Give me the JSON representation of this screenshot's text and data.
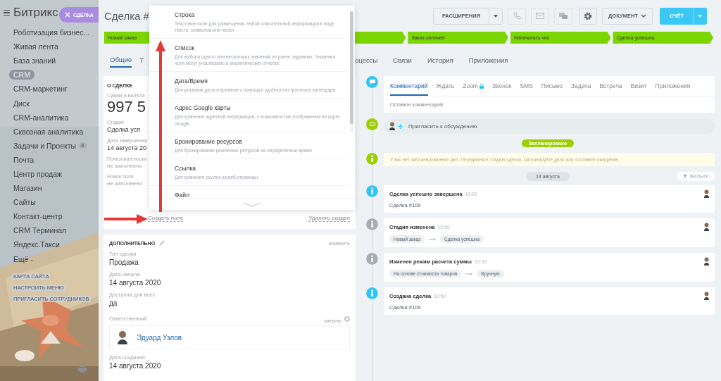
{
  "sidebar": {
    "logo": "Битрикс",
    "tag": {
      "label": "СДЕЛКА"
    },
    "items": [
      {
        "label": "Роботизация бизнес...",
        "selected": false
      },
      {
        "label": "Живая лента",
        "selected": false
      },
      {
        "label": "База знаний",
        "selected": false
      },
      {
        "label": "CRM",
        "selected": true
      },
      {
        "label": "CRM-маркетинг",
        "selected": false
      },
      {
        "label": "Диск",
        "selected": false
      },
      {
        "label": "CRM-аналитика",
        "selected": false
      },
      {
        "label": "Сквозная аналитика",
        "selected": false
      },
      {
        "label": "Задачи и Проекты",
        "badge": "4",
        "selected": false
      },
      {
        "label": "Почта",
        "selected": false
      },
      {
        "label": "Центр продаж",
        "selected": false
      },
      {
        "label": "Магазин",
        "selected": false
      },
      {
        "label": "Сайты",
        "selected": false
      },
      {
        "label": "Контакт-центр",
        "selected": false
      },
      {
        "label": "CRM Терминал",
        "selected": false
      },
      {
        "label": "Яндекс.Такси",
        "selected": false
      },
      {
        "label": "Ещё -",
        "selected": false
      }
    ],
    "footer_links": [
      "КАРТА САЙТА",
      "НАСТРОИТЬ МЕНЮ",
      "ПРИГЛАСИТЬ СОТРУДНИКОВ"
    ]
  },
  "header": {
    "title": "Сделка #",
    "extensions": "РАСШИРЕНИЯ",
    "document": "ДОКУМЕНТ",
    "invoice": "СЧЁТ"
  },
  "stages": [
    {
      "kind": "shown",
      "label": "Новый заказ"
    },
    {
      "kind": "covered"
    },
    {
      "kind": "shown",
      "label": "Заказ оплачен"
    },
    {
      "kind": "shown",
      "label": "Напечатать чек"
    },
    {
      "kind": "shown",
      "label": "Сделка успешна"
    }
  ],
  "tabs": [
    {
      "label": "Общие",
      "selected": true
    },
    {
      "label": "Т",
      "selected": false
    },
    {
      "label": "оцессы",
      "selected": false
    },
    {
      "label": "Связи",
      "selected": false
    },
    {
      "label": "История",
      "selected": false
    },
    {
      "label": "Приложения",
      "selected": false
    }
  ],
  "deal_card": {
    "title": "О СДЕЛКЕ",
    "fields": [
      {
        "kind": "amount",
        "label": "Сумма и валюта",
        "value": "997 5"
      },
      {
        "kind": "text",
        "label": "Стадия",
        "value": "Сделка усп"
      },
      {
        "kind": "text",
        "label": "Дата завершения",
        "value": "14 августа 20"
      },
      {
        "kind": "empty",
        "label": "Пользовательски",
        "value": "не заполнено"
      },
      {
        "kind": "empty",
        "label": "Новое поле",
        "value": "не заполнено"
      }
    ],
    "create_link": "Создать поле",
    "delete_link": "Удалить раздел"
  },
  "field_menu": [
    {
      "title": "Строка",
      "description": "Текстовое поле для размещения любой описательной информации в виде текста, символов или чисел."
    },
    {
      "title": "Список",
      "description": "Для выбора одного или нескольких значений из ранее заданных. Значения поля могут участвовать в аналитических отчетах."
    },
    {
      "title": "Дата/Время",
      "description": "Для указания даты и времени с помощью удобного встроенного календаря."
    },
    {
      "title": "Адрес Google карты",
      "description": "Для хранения адресной информации, с возможностью отображения на карте Google."
    },
    {
      "title": "Бронирование ресурсов",
      "description": "Для бронирования различных ресурсов на определенное время"
    },
    {
      "title": "Ссылка",
      "description": "Для хранения ссылок на веб-страницы."
    },
    {
      "title": "Файл"
    }
  ],
  "extra_card": {
    "title": "ДОПОЛНИТЕЛЬНО",
    "edit_link": "изменить",
    "fields": [
      {
        "label": "Тип сделки",
        "value": "Продажа"
      },
      {
        "label": "Дата начала",
        "value": "14 августа 2020"
      },
      {
        "label": "Доступна для всех",
        "value": "да"
      }
    ],
    "responsible": {
      "label": "Ответственный",
      "change": "сменить",
      "name": "Эдуард Узлов"
    },
    "created": {
      "label": "Дата создания",
      "value": "14 августа 2020"
    }
  },
  "activity_tabs": [
    {
      "label": "Комментарий",
      "selected": true
    },
    {
      "label": "Ждать",
      "selected": false
    },
    {
      "label": "Zoom",
      "selected": false,
      "locked": true
    },
    {
      "label": "Звонок",
      "selected": false
    },
    {
      "label": "SMS",
      "selected": false
    },
    {
      "label": "Письмо",
      "selected": false
    },
    {
      "label": "Задача",
      "selected": false
    },
    {
      "label": "Встреча",
      "selected": false
    },
    {
      "label": "Визит",
      "selected": false
    },
    {
      "label": "Приложения",
      "selected": false
    }
  ],
  "comment_placeholder": "Оставьте комментарий",
  "invite": "Пригласить к обсуждению",
  "planned_badge": "Запланировано",
  "planned_notice": "У вас нет запланированных дел. Передвиньте стадию сделки, запланируйте дело или поставьте ожидание.",
  "date_badge": "14 августа",
  "filter": "ФИЛЬТР",
  "events": [
    {
      "kind": "text",
      "color": "#2fc6f6",
      "title": "Сделка успешно завершена",
      "time": "10:50",
      "text": "Сделка #109"
    },
    {
      "kind": "change",
      "color": "#a8adb4",
      "title": "Стадия изменена",
      "time": "10:50",
      "from": "Новый заказ",
      "to": "Сделка успешна"
    },
    {
      "kind": "change",
      "color": "#a8adb4",
      "title": "Изменен режим расчета суммы",
      "time": "10:50",
      "from": "На основе стоимости товаров",
      "to": "Вручную"
    },
    {
      "kind": "text",
      "color": "#2fc6f6",
      "title": "Создана сделка",
      "time": "10:50",
      "text": "Сделка #109"
    }
  ]
}
